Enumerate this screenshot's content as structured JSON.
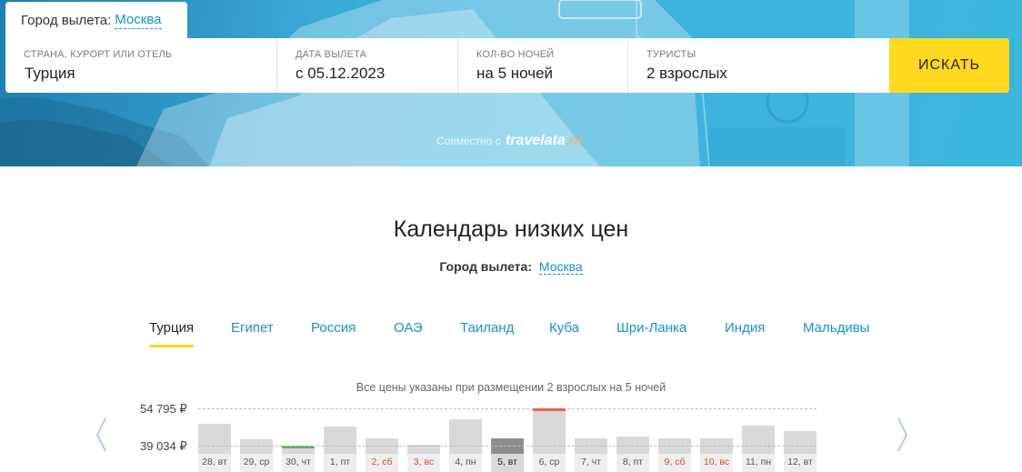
{
  "header": {
    "departure_label": "Город вылета:",
    "departure_city": "Москва"
  },
  "search": {
    "destination_label": "Страна, курорт или отель",
    "destination_value": "Турция",
    "date_label": "Дата вылета",
    "date_value": "с 05.12.2023",
    "nights_label": "Кол-во ночей",
    "nights_value": "на 5 ночей",
    "tourists_label": "Туристы",
    "tourists_value": "2 взрослых",
    "search_button": "ИСКАТЬ"
  },
  "partner": {
    "prefix": "Совместно с",
    "brand": "travelata",
    "brand_suffix": ".ru"
  },
  "calendar": {
    "title": "Календарь низких цен",
    "departure_label": "Город вылета:",
    "departure_city": "Москва",
    "tabs": [
      "Турция",
      "Египет",
      "Россия",
      "ОАЭ",
      "Таиланд",
      "Куба",
      "Шри-Ланка",
      "Индия",
      "Мальдивы"
    ],
    "active_tab": 0,
    "note": "Все цены указаны при размещении 2 взрослых на 5 ночей"
  },
  "chart_data": {
    "type": "bar",
    "y_labels": [
      "54 795 ₽",
      "39 034 ₽"
    ],
    "max_price": 54795,
    "min_price": 39034,
    "categories": [
      "28, вт",
      "29, ср",
      "30, чт",
      "1, пт",
      "2, сб",
      "3, вс",
      "4, пн",
      "5, вт",
      "6, ср",
      "7, чт",
      "8, пт",
      "9, сб",
      "10, вс",
      "11, пн",
      "12, вт"
    ],
    "weekend": [
      false,
      false,
      false,
      false,
      true,
      true,
      false,
      false,
      false,
      false,
      false,
      true,
      true,
      false,
      false
    ],
    "values": [
      48400,
      41700,
      39034,
      47000,
      42200,
      39600,
      50000,
      42000,
      54795,
      42200,
      43000,
      42200,
      42200,
      47500,
      45300
    ],
    "selected_index": 7,
    "min_index": 2,
    "max_index": 8,
    "colors": {
      "bar": "#d9d9d9",
      "selected": "#8e8e8e",
      "min": "#5cb85c",
      "max": "#e8663d"
    }
  }
}
